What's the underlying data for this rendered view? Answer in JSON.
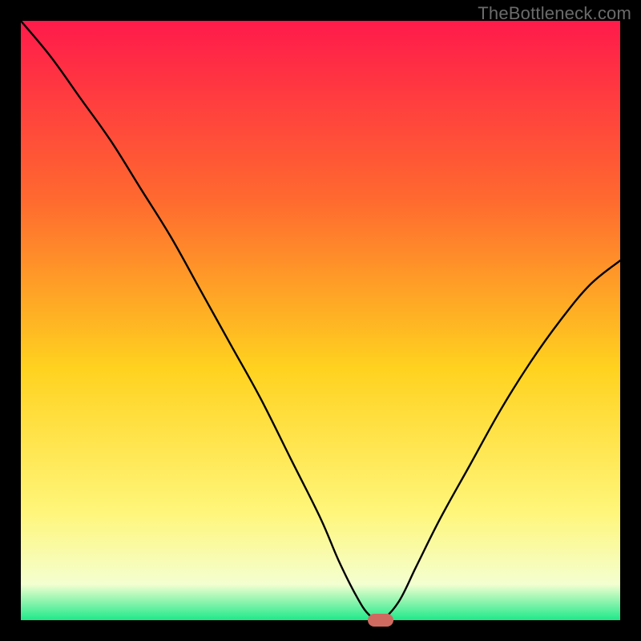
{
  "watermark": {
    "text": "TheBottleneck.com"
  },
  "colors": {
    "frame": "#000000",
    "curve": "#000000",
    "marker": "#cf6a61",
    "watermark": "#6b6b6b",
    "gradient_top": "#ff1a4b",
    "gradient_mid1": "#ff6a2f",
    "gradient_mid2": "#ffd21f",
    "gradient_mid3": "#fff67a",
    "gradient_mid4": "#f4ffd0",
    "gradient_bot": "#1ee98a"
  },
  "chart_data": {
    "type": "line",
    "title": "",
    "xlabel": "",
    "ylabel": "",
    "xlim": [
      0,
      100
    ],
    "ylim": [
      0,
      100
    ],
    "grid": false,
    "legend": false,
    "annotations": [],
    "series": [
      {
        "name": "bottleneck-curve",
        "x": [
          0,
          5,
          10,
          15,
          20,
          25,
          30,
          35,
          40,
          45,
          50,
          53,
          56,
          58,
          60,
          63,
          66,
          70,
          75,
          80,
          85,
          90,
          95,
          100
        ],
        "values": [
          100,
          94,
          87,
          80,
          72,
          64,
          55,
          46,
          37,
          27,
          17,
          10,
          4,
          1,
          0,
          3,
          9,
          17,
          26,
          35,
          43,
          50,
          56,
          60
        ]
      }
    ],
    "marker": {
      "x": 60,
      "y": 0
    }
  }
}
